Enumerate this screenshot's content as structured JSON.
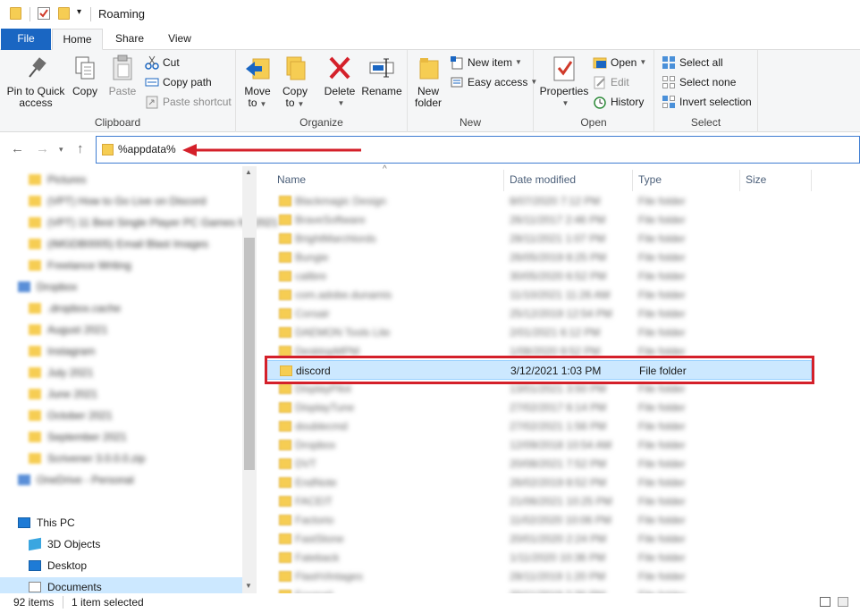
{
  "window": {
    "title": "Roaming"
  },
  "tabs": {
    "file": "File",
    "home": "Home",
    "share": "Share",
    "view": "View"
  },
  "ribbon": {
    "clipboard": {
      "label": "Clipboard",
      "pin_line1": "Pin to Quick",
      "pin_line2": "access",
      "copy": "Copy",
      "paste": "Paste",
      "cut": "Cut",
      "copy_path": "Copy path",
      "paste_shortcut": "Paste shortcut"
    },
    "organize": {
      "label": "Organize",
      "move_line1": "Move",
      "move_line2": "to",
      "copy_line1": "Copy",
      "copy_line2": "to",
      "delete": "Delete",
      "rename": "Rename"
    },
    "new": {
      "label": "New",
      "new_folder_line1": "New",
      "new_folder_line2": "folder",
      "new_item": "New item",
      "easy_access": "Easy access"
    },
    "open": {
      "label": "Open",
      "properties": "Properties",
      "open": "Open",
      "edit": "Edit",
      "history": "History"
    },
    "select": {
      "label": "Select",
      "select_all": "Select all",
      "select_none": "Select none",
      "invert": "Invert selection"
    }
  },
  "address": {
    "path": "%appdata%"
  },
  "sidebar": {
    "blurred_items": [
      "Pictures",
      "(VPT) How to Go Live on Discord",
      "(VPT) 11 Best Single Player PC Games for 2021",
      "(IMGDB0005) Email Blast Images",
      "Freelance Writing",
      "Dropbox",
      ".dropbox.cache",
      "August 2021",
      "Instagram",
      "July 2021",
      "June 2021",
      "October 2021",
      "September 2021",
      "Scrivener 3.0.0.0.zip",
      "OneDrive - Personal"
    ],
    "this_pc": "This PC",
    "objects_3d": "3D Objects",
    "desktop": "Desktop",
    "documents": "Documents"
  },
  "columns": {
    "name": "Name",
    "date": "Date modified",
    "type": "Type",
    "size": "Size"
  },
  "rows": [
    {
      "name": "Blackmagic Design",
      "date": "8/07/2020 7:12 PM",
      "type": "File folder"
    },
    {
      "name": "BraveSoftware",
      "date": "26/11/2017 2:46 PM",
      "type": "File folder"
    },
    {
      "name": "BrightMarchlords",
      "date": "28/11/2021 1:07 PM",
      "type": "File folder"
    },
    {
      "name": "Bungie",
      "date": "26/05/2019 8:25 PM",
      "type": "File folder"
    },
    {
      "name": "calibre",
      "date": "30/05/2020 6:52 PM",
      "type": "File folder"
    },
    {
      "name": "com.adobe.dunamis",
      "date": "11/10/2021 11:26 AM",
      "type": "File folder"
    },
    {
      "name": "Corsair",
      "date": "25/12/2019 12:54 PM",
      "type": "File folder"
    },
    {
      "name": "DAEMON Tools Lite",
      "date": "2/01/2021 6:12 PM",
      "type": "File folder"
    },
    {
      "name": "DesktopMPM",
      "date": "1/08/2020 9:52 PM",
      "type": "File folder"
    },
    {
      "name": "discord",
      "date": "3/12/2021 1:03 PM",
      "type": "File folder"
    },
    {
      "name": "DisplayPilot",
      "date": "13/01/2021 3:50 PM",
      "type": "File folder"
    },
    {
      "name": "DisplayTune",
      "date": "27/02/2017 6:14 PM",
      "type": "File folder"
    },
    {
      "name": "doublecmd",
      "date": "27/02/2021 1:56 PM",
      "type": "File folder"
    },
    {
      "name": "Dropbox",
      "date": "12/09/2018 10:54 AM",
      "type": "File folder"
    },
    {
      "name": "DVT",
      "date": "20/08/2021 7:52 PM",
      "type": "File folder"
    },
    {
      "name": "EndNote",
      "date": "26/02/2019 8:52 PM",
      "type": "File folder"
    },
    {
      "name": "FACEIT",
      "date": "21/06/2021 10:25 PM",
      "type": "File folder"
    },
    {
      "name": "Factorio",
      "date": "11/02/2020 10:06 PM",
      "type": "File folder"
    },
    {
      "name": "FastStone",
      "date": "20/01/2020 2:24 PM",
      "type": "File folder"
    },
    {
      "name": "Fateback",
      "date": "1/11/2020 10:36 PM",
      "type": "File folder"
    },
    {
      "name": "FlashVintages",
      "date": "28/11/2019 1:20 PM",
      "type": "File folder"
    },
    {
      "name": "Foxmail",
      "date": "20/11/2019 2:30 PM",
      "type": "File folder"
    }
  ],
  "selected_index": 9,
  "status": {
    "items": "92 items",
    "selected": "1 item selected"
  },
  "colors": {
    "accent": "#1a66c2",
    "highlight": "#d4202a",
    "selection": "#cce8ff"
  }
}
